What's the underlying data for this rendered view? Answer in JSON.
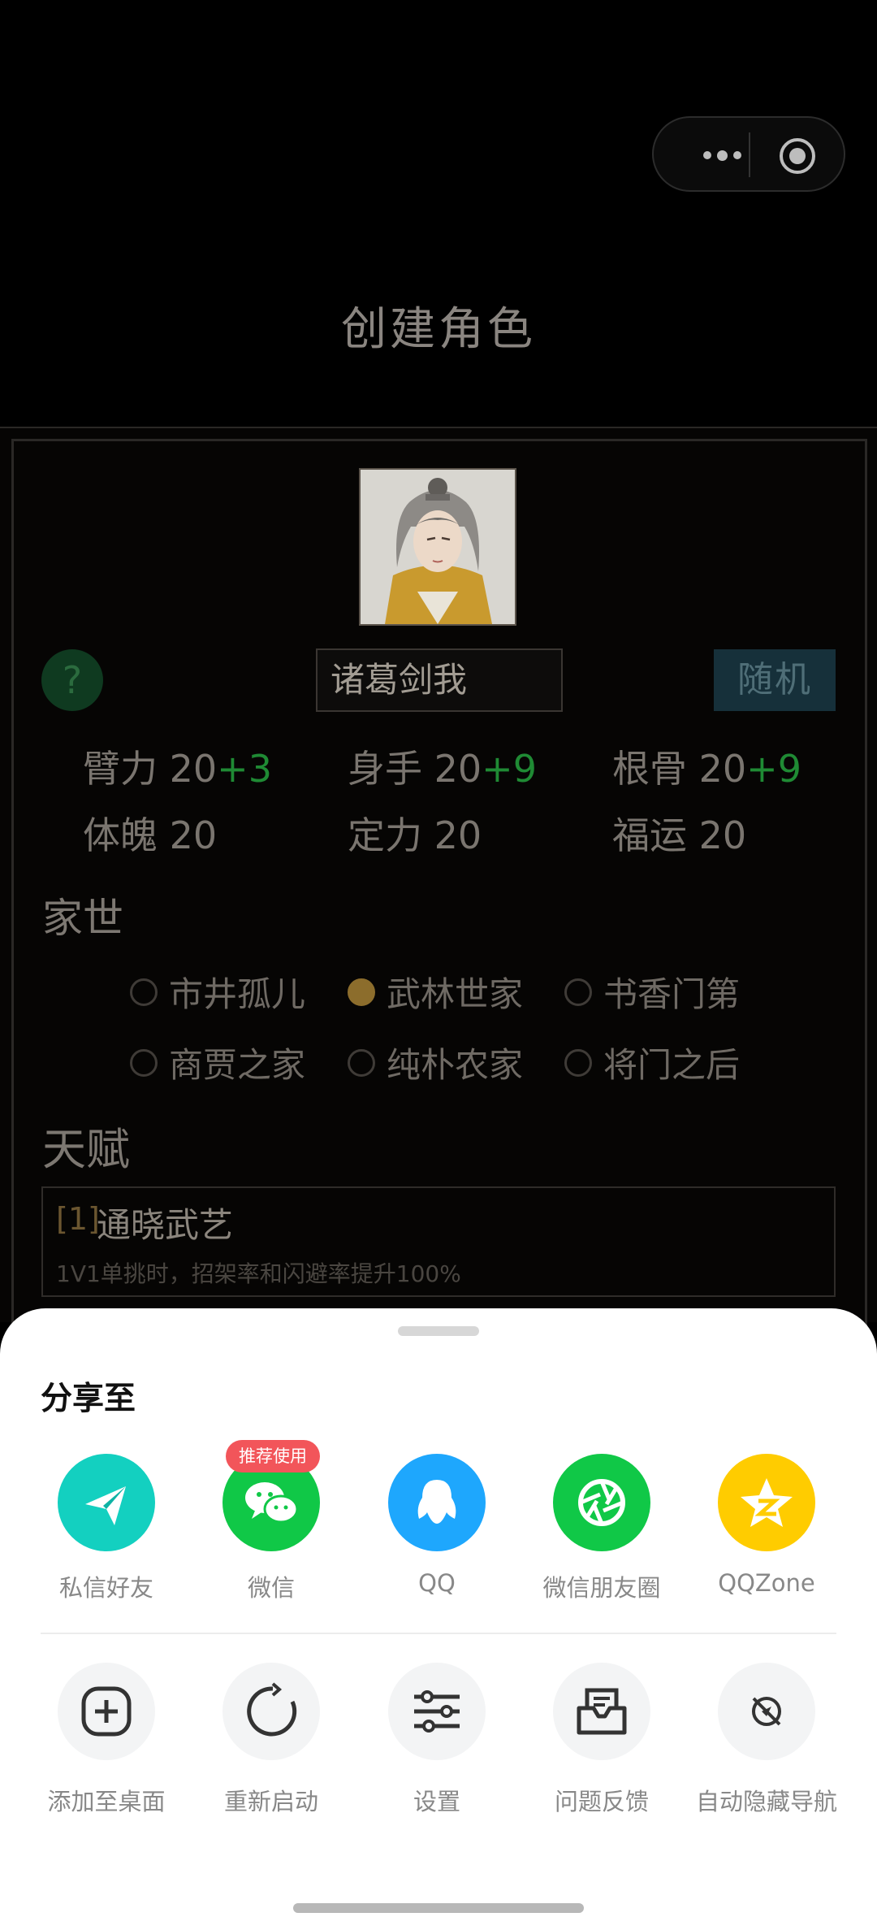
{
  "page": {
    "title": "创建角色"
  },
  "character": {
    "help": "?",
    "name": "诸葛剑我",
    "random_label": "随机",
    "stats": [
      {
        "label": "臂力",
        "base": "20",
        "bonus": "+3"
      },
      {
        "label": "身手",
        "base": "20",
        "bonus": "+9"
      },
      {
        "label": "根骨",
        "base": "20",
        "bonus": "+9"
      },
      {
        "label": "体魄",
        "base": "20",
        "bonus": ""
      },
      {
        "label": "定力",
        "base": "20",
        "bonus": ""
      },
      {
        "label": "福运",
        "base": "20",
        "bonus": ""
      }
    ],
    "family_title": "家世",
    "family_options": [
      {
        "label": "市井孤儿",
        "selected": false
      },
      {
        "label": "武林世家",
        "selected": true
      },
      {
        "label": "书香门第",
        "selected": false
      },
      {
        "label": "商贾之家",
        "selected": false
      },
      {
        "label": "纯朴农家",
        "selected": false
      },
      {
        "label": "将门之后",
        "selected": false
      }
    ],
    "talent_title": "天赋",
    "talent": {
      "index": "[1]",
      "name": "通晓武艺",
      "desc": "1V1单挑时，招架率和闪避率提升100%"
    }
  },
  "share_sheet": {
    "title": "分享至",
    "badge": "推荐使用",
    "apps": [
      {
        "label": "私信好友",
        "icon": "paper-plane-icon",
        "color": "#13d0c0"
      },
      {
        "label": "微信",
        "icon": "wechat-icon",
        "color": "#10c847"
      },
      {
        "label": "QQ",
        "icon": "qq-penguin-icon",
        "color": "#1ea7fd"
      },
      {
        "label": "微信朋友圈",
        "icon": "moments-aperture-icon",
        "color": "#10c847"
      },
      {
        "label": "QQZone",
        "icon": "qzone-star-icon",
        "color": "#ffcc00"
      }
    ],
    "tools": [
      {
        "label": "添加至桌面",
        "icon": "add-square-icon"
      },
      {
        "label": "重新启动",
        "icon": "restart-icon"
      },
      {
        "label": "设置",
        "icon": "settings-sliders-icon"
      },
      {
        "label": "问题反馈",
        "icon": "feedback-icon"
      },
      {
        "label": "自动隐藏导航",
        "icon": "hide-nav-icon"
      }
    ]
  }
}
